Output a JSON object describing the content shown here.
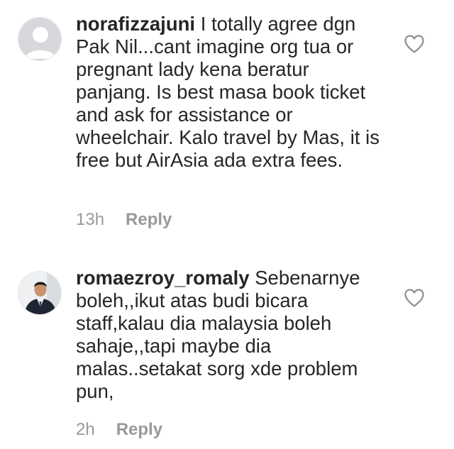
{
  "comments": [
    {
      "username": "norafizzajuni",
      "text": " I totally agree dgn Pak Nil...cant imagine org tua  or pregnant lady kena beratur panjang. Is best masa book ticket and ask for assistance or wheelchair. Kalo travel by Mas, it is free but AirAsia ada extra fees.",
      "time": "13h",
      "reply_label": "Reply",
      "avatar_icon": "default-user-avatar-icon",
      "like_icon": "heart-outline-icon"
    },
    {
      "username": "romaezroy_romaly",
      "text": " Sebenarnye boleh,,ikut atas budi bicara staff,kalau dia malaysia boleh sahaje,,tapi maybe dia malas..setakat sorg xde problem pun,",
      "time": "2h",
      "reply_label": "Reply",
      "avatar_icon": "user-photo-avatar",
      "like_icon": "heart-outline-icon"
    }
  ],
  "colors": {
    "text": "#262626",
    "meta": "#999999",
    "avatar_default_bg": "#d6d8dc"
  }
}
